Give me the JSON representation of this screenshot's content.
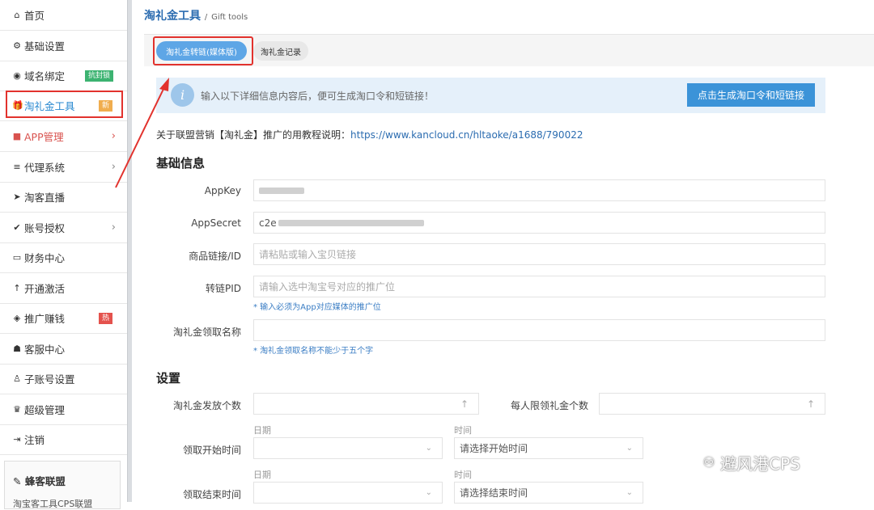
{
  "sidebar": {
    "items": [
      {
        "icon": "⌂",
        "label": "首页"
      },
      {
        "icon": "⚙",
        "label": "基础设置"
      },
      {
        "icon": "◉",
        "label": "域名绑定",
        "badge": "抗封锁"
      },
      {
        "icon": "🎁",
        "label": "淘礼金工具",
        "badge": "新"
      },
      {
        "icon": "■",
        "label": "APP管理",
        "arrow": "›"
      },
      {
        "icon": "≡",
        "label": "代理系统",
        "arrow": "›"
      },
      {
        "icon": "➤",
        "label": "淘客直播"
      },
      {
        "icon": "✔",
        "label": "账号授权",
        "arrow": "›"
      },
      {
        "icon": "▭",
        "label": "财务中心"
      },
      {
        "icon": "↑",
        "label": "开通激活"
      },
      {
        "icon": "◈",
        "label": "推广赚钱",
        "badge": "热"
      },
      {
        "icon": "☗",
        "label": "客服中心"
      },
      {
        "icon": "♙",
        "label": "子账号设置"
      },
      {
        "icon": "♛",
        "label": "超级管理"
      },
      {
        "icon": "⇥",
        "label": "注销"
      }
    ],
    "footer_title": "蜂客联盟",
    "footer_sub": "淘宝客工具CPS联盟"
  },
  "breadcrumb": {
    "title": "淘礼金工具",
    "sep": "/",
    "sub": "Gift tools"
  },
  "tabs": [
    "淘礼金转链(媒体版)",
    "淘礼金记录"
  ],
  "info": {
    "icon": "i",
    "text": "输入以下详细信息内容后，便可生成淘口令和短链接！",
    "button": "点击生成淘口令和短链接"
  },
  "tutorial": {
    "text": "关于联盟营销【淘礼金】推广的用教程说明：",
    "link": "https://www.kancloud.cn/hltaoke/a1688/790022"
  },
  "basic": {
    "title": "基础信息",
    "appkey_label": "AppKey",
    "appsecret_label": "AppSecret",
    "appsecret_prefix": "c2e",
    "goods_label": "商品链接/ID",
    "goods_placeholder": "请粘贴或输入宝贝链接",
    "pid_label": "转链PID",
    "pid_placeholder": "请输入选中淘宝号对应的推广位",
    "pid_hint": "* 输入必须为App对应媒体的推广位",
    "name_label": "淘礼金领取名称",
    "name_hint": "* 淘礼金领取名称不能少于五个字"
  },
  "settings": {
    "title": "设置",
    "count_label": "淘礼金发放个数",
    "per_label": "每人限领礼金个数",
    "up_icon": "↑",
    "date_caption": "日期",
    "time_caption": "时间",
    "start_label": "领取开始时间",
    "start_time_placeholder": "请选择开始时间",
    "end_label": "领取结束时间",
    "end_time_placeholder": "请选择结束时间",
    "chevron": "⌄"
  },
  "watermark": "避风港CPS",
  "colors": {
    "accent": "#3b93d8",
    "highlight": "#e2322d"
  }
}
